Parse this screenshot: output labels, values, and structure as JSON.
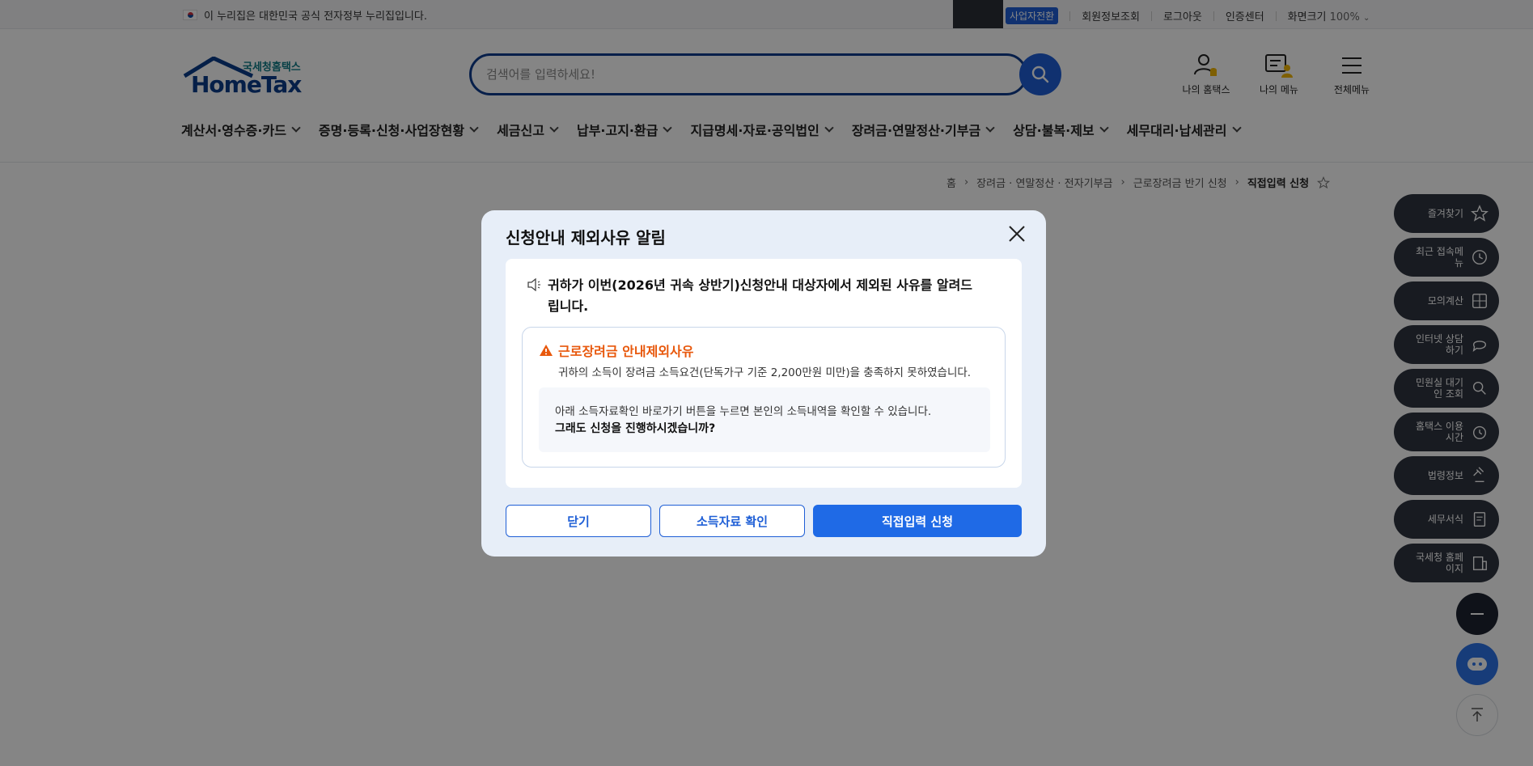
{
  "topbar": {
    "notice": "이 누리집은 대한민국 공식 전자정부 누리집입니다.",
    "biz_switch": "사업자전환",
    "links": [
      "회원정보조회",
      "로그아웃",
      "인증센터"
    ],
    "font_size_label": "화면크기",
    "zoom": "100%"
  },
  "logo": {
    "sub": "국세청홈택스",
    "main": "HomeTax"
  },
  "search": {
    "placeholder": "검색어를 입력하세요!"
  },
  "header_icons": {
    "my_hometax": "나의 홈택스",
    "my_menu": "나의 메뉴",
    "all_menu": "전체메뉴"
  },
  "gnb": [
    "계산서·영수증·카드",
    "증명·등록·신청·사업장현황",
    "세금신고",
    "납부·고지·환급",
    "지급명세·자료·공익법인",
    "장려금·연말정산·기부금",
    "상담·불복·제보",
    "세무대리·납세관리"
  ],
  "breadcrumb": [
    "홈",
    "장려금 · 연말정산 · 전자기부금",
    "근로장려금 반기 신청",
    "직접입력 신청"
  ],
  "quick_menu": [
    {
      "label": "즐겨찾기",
      "icon": "star-icon"
    },
    {
      "label": "최근 접속메뉴",
      "icon": "clock-icon"
    },
    {
      "label": "모의계산",
      "icon": "calculator-icon"
    },
    {
      "label": "인터넷 상담하기",
      "icon": "chat-icon"
    },
    {
      "label": "민원실 대기인 조회",
      "icon": "people-search-icon"
    },
    {
      "label": "홈택스 이용시간",
      "icon": "alarm-icon"
    },
    {
      "label": "법령정보",
      "icon": "gavel-icon"
    },
    {
      "label": "세무서식",
      "icon": "form-icon"
    },
    {
      "label": "국세청 홈페이지",
      "icon": "building-icon"
    }
  ],
  "modal": {
    "title": "신청안내 제외사유 알림",
    "intro": "귀하가 이번(2026년 귀속 상반기)신청안내 대상자에서 제외된 사유를 알려드립니다.",
    "reason_title": "근로장려금 안내제외사유",
    "reason_desc": "귀하의 소득이 장려금 소득요건(단독가구 기준 2,200만원 미만)을 충족하지 못하였습니다.",
    "info_line1": "아래 소득자료확인 바로가기 버튼을 누르면 본인의 소득내역을 확인할 수 있습니다.",
    "info_line2": "그래도 신청을 진행하시겠습니까?",
    "buttons": {
      "close": "닫기",
      "income_check": "소득자료 확인",
      "apply": "직접입력 신청"
    }
  },
  "colors": {
    "primary": "#1f5fd6",
    "warning": "#e8580c",
    "modal_bg": "#e7eef8"
  }
}
